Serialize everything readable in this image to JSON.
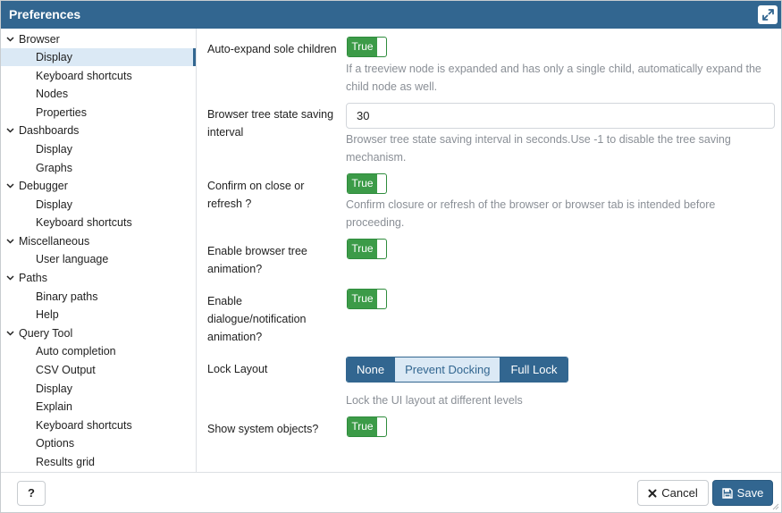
{
  "window": {
    "title": "Preferences"
  },
  "sidebar": {
    "tree": [
      {
        "type": "parent",
        "label": "Browser"
      },
      {
        "type": "child",
        "label": "Display",
        "selected": true
      },
      {
        "type": "child",
        "label": "Keyboard shortcuts"
      },
      {
        "type": "child",
        "label": "Nodes"
      },
      {
        "type": "child",
        "label": "Properties"
      },
      {
        "type": "parent",
        "label": "Dashboards"
      },
      {
        "type": "child",
        "label": "Display"
      },
      {
        "type": "child",
        "label": "Graphs"
      },
      {
        "type": "parent",
        "label": "Debugger"
      },
      {
        "type": "child",
        "label": "Display"
      },
      {
        "type": "child",
        "label": "Keyboard shortcuts"
      },
      {
        "type": "parent",
        "label": "Miscellaneous"
      },
      {
        "type": "child",
        "label": "User language"
      },
      {
        "type": "parent",
        "label": "Paths"
      },
      {
        "type": "child",
        "label": "Binary paths"
      },
      {
        "type": "child",
        "label": "Help"
      },
      {
        "type": "parent",
        "label": "Query Tool"
      },
      {
        "type": "child",
        "label": "Auto completion"
      },
      {
        "type": "child",
        "label": "CSV Output"
      },
      {
        "type": "child",
        "label": "Display"
      },
      {
        "type": "child",
        "label": "Explain"
      },
      {
        "type": "child",
        "label": "Keyboard shortcuts"
      },
      {
        "type": "child",
        "label": "Options"
      },
      {
        "type": "child",
        "label": "Results grid"
      }
    ]
  },
  "prefs": {
    "auto_expand": {
      "label": "Auto-expand sole children",
      "value": "True",
      "help": "If a treeview node is expanded and has only a single child, automatically expand the child node as well."
    },
    "tree_state_interval": {
      "label": "Browser tree state saving interval",
      "value": "30",
      "help": "Browser tree state saving interval in seconds.Use -1 to disable the tree saving mechanism."
    },
    "confirm_close": {
      "label": "Confirm on close or refresh ?",
      "value": "True",
      "help": "Confirm closure or refresh of the browser or browser tab is intended before proceeding."
    },
    "tree_animation": {
      "label": "Enable browser tree animation?",
      "value": "True"
    },
    "dialogue_animation": {
      "label": "Enable dialogue/notification animation?",
      "value": "True"
    },
    "lock_layout": {
      "label": "Lock Layout",
      "options": [
        "None",
        "Prevent Docking",
        "Full Lock"
      ],
      "selected": "Prevent Docking",
      "help": "Lock the UI layout at different levels"
    },
    "system_objects": {
      "label": "Show system objects?",
      "value": "True"
    }
  },
  "footer": {
    "help_label": "?",
    "cancel_label": "Cancel",
    "save_label": "Save"
  },
  "colors": {
    "primary": "#326690",
    "toggle_on": "#3c9b48",
    "selected_bg": "#dbe9f5",
    "help_text": "#8a8f96"
  }
}
